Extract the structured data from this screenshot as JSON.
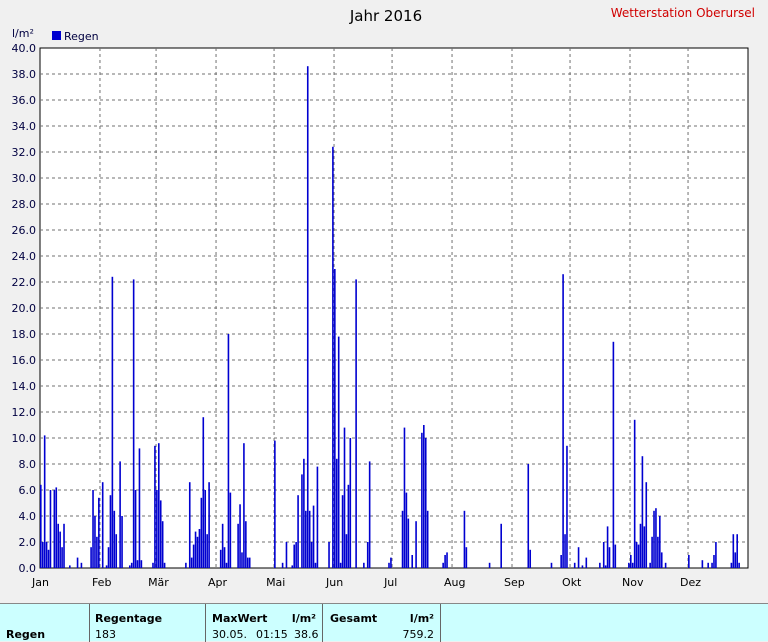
{
  "header": {
    "title": "Jahr 2016",
    "station": "Wetterstation Oberursel"
  },
  "chart_data": {
    "type": "bar",
    "title": "Jahr 2016",
    "ylabel": "l/m²",
    "ylim": [
      0,
      40
    ],
    "yticks": [
      "0.0",
      "2.0",
      "4.0",
      "6.0",
      "8.0",
      "10.0",
      "12.0",
      "14.0",
      "16.0",
      "18.0",
      "20.0",
      "22.0",
      "24.0",
      "26.0",
      "28.0",
      "30.0",
      "32.0",
      "34.0",
      "36.0",
      "38.0",
      "40.0"
    ],
    "months": [
      "Jan",
      "Feb",
      "Mär",
      "Apr",
      "Mai",
      "Jun",
      "Jul",
      "Aug",
      "Sep",
      "Okt",
      "Nov",
      "Dez"
    ],
    "grid": true,
    "legend": "top-left",
    "series": [
      {
        "name": "Regen",
        "color": "#0000d0",
        "points": [
          [
            1,
            6.4
          ],
          [
            2,
            2.0
          ],
          [
            3,
            10.2
          ],
          [
            4,
            2.0
          ],
          [
            5,
            1.4
          ],
          [
            6,
            6.0
          ],
          [
            8,
            6.0
          ],
          [
            9,
            6.2
          ],
          [
            10,
            3.4
          ],
          [
            11,
            2.8
          ],
          [
            12,
            1.6
          ],
          [
            13,
            3.4
          ],
          [
            16,
            0.2
          ],
          [
            20,
            0.8
          ],
          [
            22,
            0.4
          ],
          [
            27,
            1.6
          ],
          [
            28,
            6.0
          ],
          [
            29,
            4.0
          ],
          [
            30,
            2.4
          ],
          [
            31,
            5.4
          ],
          [
            33,
            6.6
          ],
          [
            35,
            0.2
          ],
          [
            36,
            1.6
          ],
          [
            37,
            5.6
          ],
          [
            38,
            22.4
          ],
          [
            39,
            4.4
          ],
          [
            40,
            2.6
          ],
          [
            42,
            8.2
          ],
          [
            43,
            4.0
          ],
          [
            47,
            0.2
          ],
          [
            48,
            0.4
          ],
          [
            49,
            22.2
          ],
          [
            50,
            6.0
          ],
          [
            51,
            0.6
          ],
          [
            52,
            9.2
          ],
          [
            53,
            0.6
          ],
          [
            59,
            0.4
          ],
          [
            60,
            9.4
          ],
          [
            61,
            6.0
          ],
          [
            62,
            9.6
          ],
          [
            63,
            5.2
          ],
          [
            64,
            3.6
          ],
          [
            65,
            0.4
          ],
          [
            76,
            0.4
          ],
          [
            78,
            6.6
          ],
          [
            79,
            0.8
          ],
          [
            80,
            1.8
          ],
          [
            81,
            2.8
          ],
          [
            82,
            2.4
          ],
          [
            83,
            3.0
          ],
          [
            84,
            5.4
          ],
          [
            85,
            11.6
          ],
          [
            86,
            6.0
          ],
          [
            87,
            2.6
          ],
          [
            88,
            6.6
          ],
          [
            94,
            1.4
          ],
          [
            95,
            3.4
          ],
          [
            96,
            1.6
          ],
          [
            97,
            0.4
          ],
          [
            98,
            18.0
          ],
          [
            99,
            5.8
          ],
          [
            103,
            3.4
          ],
          [
            104,
            4.9
          ],
          [
            105,
            1.2
          ],
          [
            106,
            9.6
          ],
          [
            107,
            3.6
          ],
          [
            108,
            0.8
          ],
          [
            109,
            0.8
          ],
          [
            122,
            9.8
          ],
          [
            126,
            0.4
          ],
          [
            128,
            2.0
          ],
          [
            131,
            0.2
          ],
          [
            132,
            1.8
          ],
          [
            133,
            2.0
          ],
          [
            134,
            5.6
          ],
          [
            136,
            7.2
          ],
          [
            137,
            8.4
          ],
          [
            138,
            4.4
          ],
          [
            139,
            38.6
          ],
          [
            140,
            4.4
          ],
          [
            141,
            2.0
          ],
          [
            142,
            4.8
          ],
          [
            143,
            0.4
          ],
          [
            144,
            7.8
          ],
          [
            150,
            2.0
          ],
          [
            152,
            32.4
          ],
          [
            153,
            23.0
          ],
          [
            154,
            8.4
          ],
          [
            155,
            17.8
          ],
          [
            156,
            0.4
          ],
          [
            157,
            5.6
          ],
          [
            158,
            10.8
          ],
          [
            159,
            2.6
          ],
          [
            160,
            6.4
          ],
          [
            161,
            10.0
          ],
          [
            164,
            22.2
          ],
          [
            168,
            0.4
          ],
          [
            170,
            2.0
          ],
          [
            171,
            8.2
          ],
          [
            181,
            0.4
          ],
          [
            182,
            0.8
          ],
          [
            188,
            4.4
          ],
          [
            189,
            10.8
          ],
          [
            190,
            5.8
          ],
          [
            191,
            3.8
          ],
          [
            193,
            1.0
          ],
          [
            195,
            3.6
          ],
          [
            198,
            10.4
          ],
          [
            199,
            11.0
          ],
          [
            200,
            10.0
          ],
          [
            201,
            4.4
          ],
          [
            209,
            0.4
          ],
          [
            210,
            1.0
          ],
          [
            211,
            1.2
          ],
          [
            220,
            4.4
          ],
          [
            221,
            1.6
          ],
          [
            233,
            0.4
          ],
          [
            239,
            3.4
          ],
          [
            253,
            8.0
          ],
          [
            254,
            1.4
          ],
          [
            265,
            0.4
          ],
          [
            270,
            1.0
          ],
          [
            271,
            22.6
          ],
          [
            272,
            2.6
          ],
          [
            273,
            9.4
          ],
          [
            277,
            0.4
          ],
          [
            279,
            1.6
          ],
          [
            281,
            0.2
          ],
          [
            283,
            0.8
          ],
          [
            290,
            0.4
          ],
          [
            292,
            2.0
          ],
          [
            293,
            0.2
          ],
          [
            294,
            3.2
          ],
          [
            295,
            1.6
          ],
          [
            297,
            17.4
          ],
          [
            298,
            1.8
          ],
          [
            305,
            0.4
          ],
          [
            306,
            1.0
          ],
          [
            307,
            0.4
          ],
          [
            308,
            11.4
          ],
          [
            309,
            2.0
          ],
          [
            310,
            1.8
          ],
          [
            311,
            3.4
          ],
          [
            312,
            8.6
          ],
          [
            313,
            3.2
          ],
          [
            314,
            6.6
          ],
          [
            316,
            0.4
          ],
          [
            317,
            2.4
          ],
          [
            318,
            4.4
          ],
          [
            319,
            4.6
          ],
          [
            320,
            2.4
          ],
          [
            321,
            4.0
          ],
          [
            322,
            1.2
          ],
          [
            324,
            0.4
          ],
          [
            336,
            1.0
          ],
          [
            343,
            0.6
          ],
          [
            346,
            0.4
          ],
          [
            348,
            0.4
          ],
          [
            349,
            1.0
          ],
          [
            350,
            2.0
          ],
          [
            358,
            0.4
          ],
          [
            359,
            2.6
          ],
          [
            360,
            1.2
          ],
          [
            361,
            2.6
          ],
          [
            362,
            0.4
          ]
        ]
      }
    ]
  },
  "summary": {
    "row_label": "Regen",
    "regentage_label": "Regentage",
    "regentage_value": "183",
    "maxwert_label": "MaxWert",
    "maxwert_unit": "l/m²",
    "maxwert_date": "30.05.",
    "maxwert_time": "01:15",
    "maxwert_value": "38.6",
    "gesamt_label": "Gesamt",
    "gesamt_unit": "l/m²",
    "gesamt_value": "759.2"
  }
}
